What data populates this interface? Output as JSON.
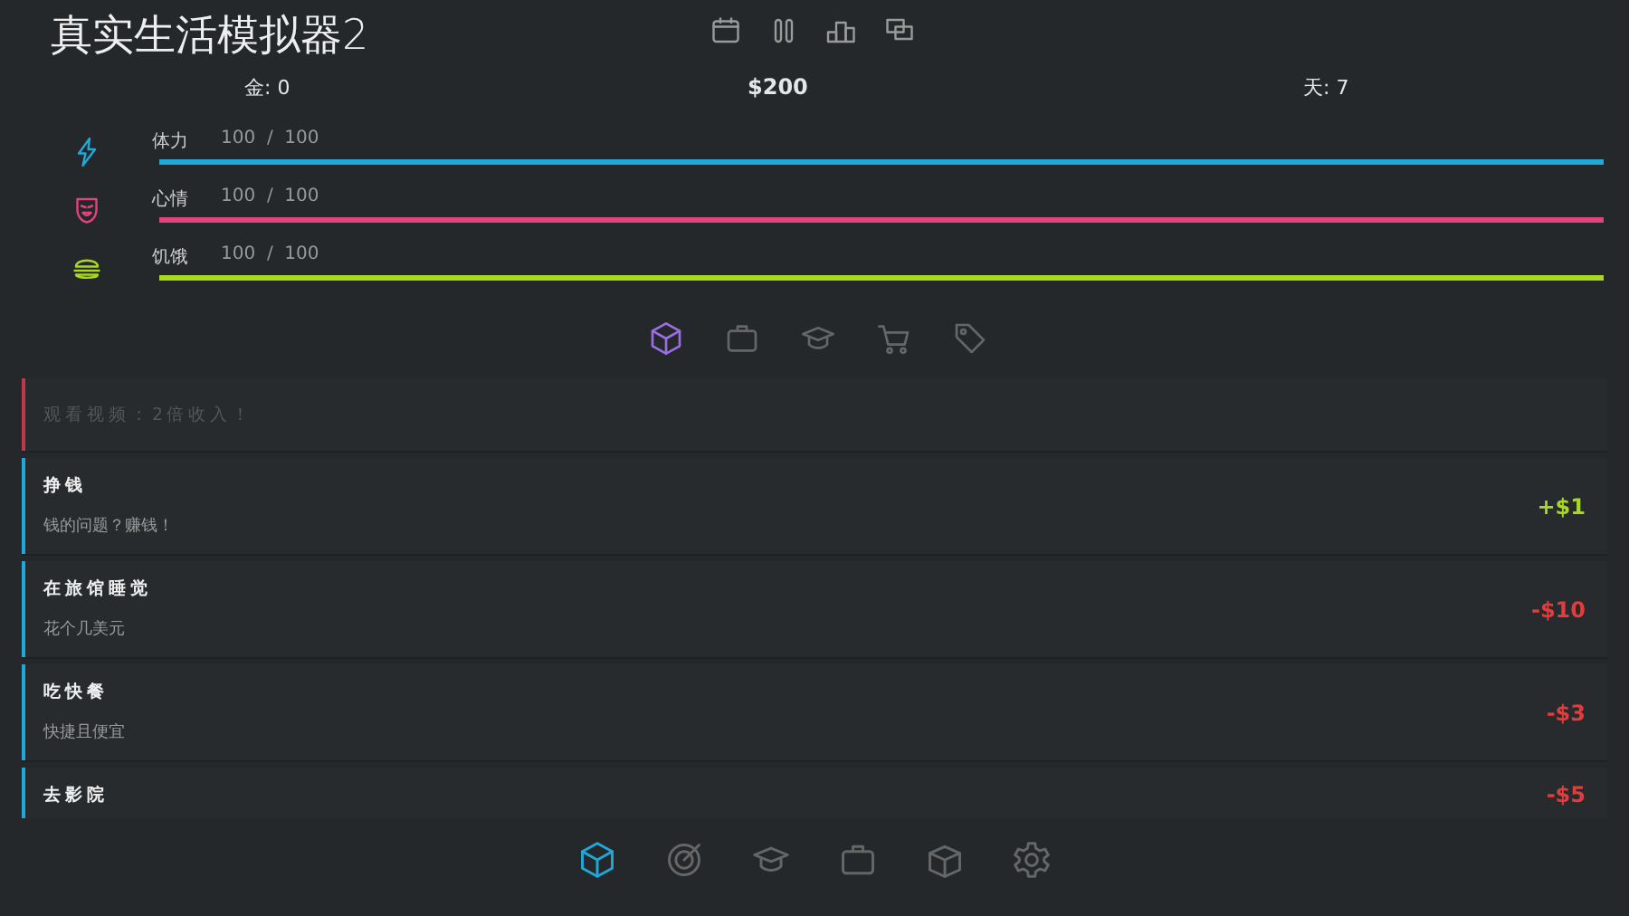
{
  "header": {
    "title": "真实生活模拟器2",
    "toolbar": [
      {
        "kind": "calendar"
      },
      {
        "kind": "pause"
      },
      {
        "kind": "podium"
      },
      {
        "kind": "chat"
      }
    ]
  },
  "stats": {
    "gold": "金: 0",
    "money": "$200",
    "day": "天: 7"
  },
  "meters": [
    {
      "kind": "energy",
      "label": "体力",
      "value": "100  /  100",
      "color": "#1fa8d8"
    },
    {
      "kind": "mood",
      "label": "心情",
      "value": "100  /  100",
      "color": "#e0447a"
    },
    {
      "kind": "food",
      "label": "饥饿",
      "value": "100  /  100",
      "color": "#a8d81f"
    }
  ],
  "categories": [
    {
      "kind": "cube",
      "selected": true
    },
    {
      "kind": "briefcase",
      "selected": false
    },
    {
      "kind": "cap",
      "selected": false
    },
    {
      "kind": "cart",
      "selected": false
    },
    {
      "kind": "tag",
      "selected": false
    }
  ],
  "actions": [
    {
      "title": "观看视频：2倍收入！",
      "disabled": true,
      "color": "#c0394a"
    },
    {
      "title": "挣钱",
      "subtitle": "钱的问题？赚钱！",
      "amount": "+$1",
      "kind": "gain",
      "disabled": false,
      "color": "#1fa8d8"
    },
    {
      "title": "在旅馆睡觉",
      "subtitle": "花个几美元",
      "amount": "-$10",
      "kind": "cost",
      "disabled": false,
      "color": "#1fa8d8"
    },
    {
      "title": "吃快餐",
      "subtitle": "快捷且便宜",
      "amount": "-$3",
      "kind": "cost",
      "disabled": false,
      "color": "#1fa8d8"
    },
    {
      "title": "去影院",
      "amount": "-$5",
      "kind": "cost",
      "disabled": false,
      "color": "#1fa8d8"
    }
  ],
  "nav": [
    {
      "kind": "cube",
      "selected": true
    },
    {
      "kind": "target",
      "selected": false
    },
    {
      "kind": "cap",
      "selected": false
    },
    {
      "kind": "briefcase",
      "selected": false
    },
    {
      "kind": "box",
      "selected": false
    },
    {
      "kind": "gear",
      "selected": false
    }
  ]
}
